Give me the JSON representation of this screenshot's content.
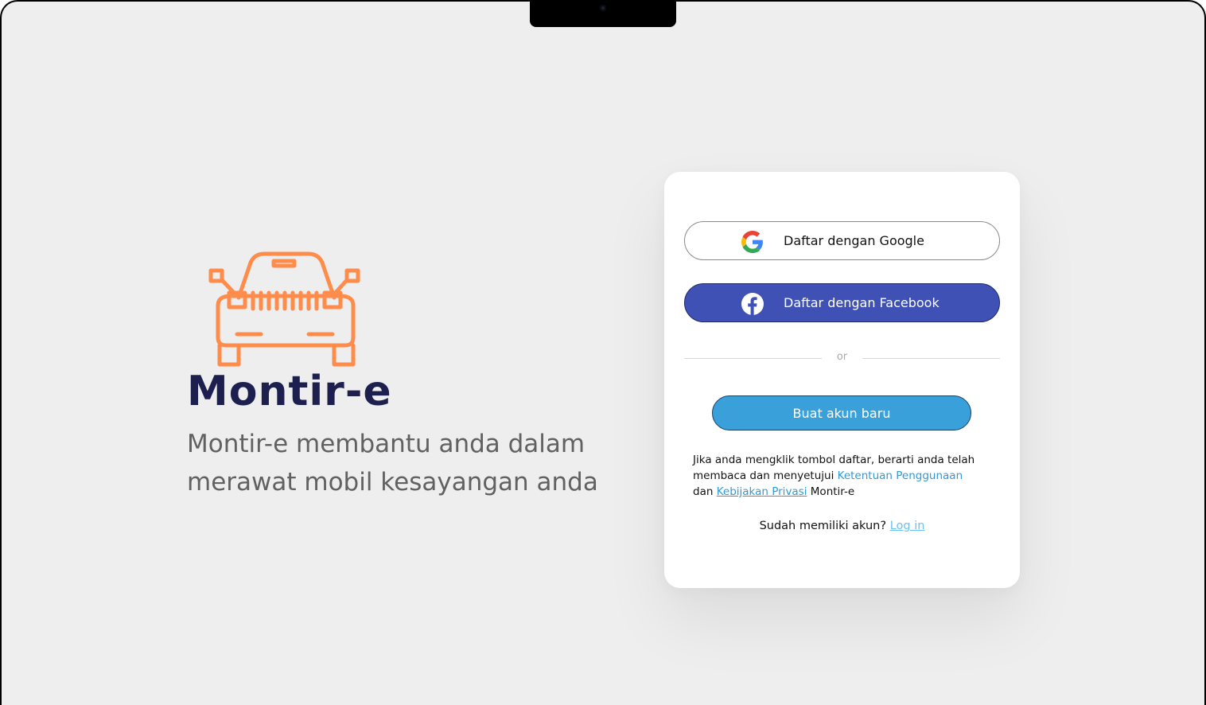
{
  "brand": {
    "name": "Montir-e",
    "tagline": "Montir-e membantu anda dalam merawat mobil kesayangan anda",
    "logo_icon": "car-front-icon",
    "accent_color": "#ff8c4b",
    "name_color": "#1d1f4e"
  },
  "signup": {
    "google_label": "Daftar dengan Google",
    "google_icon": "google-icon",
    "facebook_label": "Daftar dengan Facebook",
    "facebook_icon": "facebook-icon",
    "facebook_color": "#3f51b5",
    "divider_text": "or",
    "create_account_label": "Buat akun baru",
    "create_account_color": "#3aa0d9",
    "terms_text_1": "Jika anda mengklik tombol daftar, berarti anda telah membaca dan menyetujui",
    "terms_link_1": "Ketentuan Penggunaan",
    "terms_text_2": "dan",
    "terms_link_2": "Kebijakan Privasi",
    "terms_text_3": "Montir-e",
    "login_prompt": "Sudah memiliki akun?",
    "login_link": "Log in"
  }
}
